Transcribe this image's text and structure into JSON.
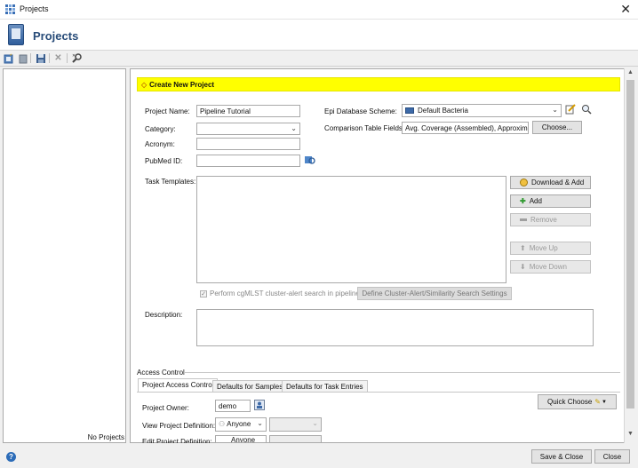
{
  "window": {
    "title": "Projects",
    "close_glyph": "✕"
  },
  "header": {
    "title": "Projects",
    "icon": "project-book-icon"
  },
  "toolbar": {
    "icons": [
      "new-project-icon",
      "delete-icon",
      "save-icon",
      "cancel-icon",
      "settings-icon"
    ]
  },
  "left_panel": {
    "footer_text": "No Projects"
  },
  "form": {
    "banner": "Create New Project",
    "project_name_label": "Project Name:",
    "project_name_value": "Pipeline Tutorial",
    "category_label": "Category:",
    "category_value": "",
    "acronym_label": "Acronym:",
    "acronym_value": "",
    "pubmed_label": "PubMed ID:",
    "pubmed_value": "",
    "epi_scheme_label": "Epi Database Scheme:",
    "epi_scheme_value": "Default Bacteria",
    "comparison_fields_label": "Comparison Table Fields:",
    "comparison_fields_value": "Avg. Coverage (Assembled), Approximat",
    "choose_button": "Choose...",
    "task_templates_label": "Task Templates:",
    "download_add_button": "Download & Add",
    "add_button": "Add",
    "remove_button": "Remove",
    "move_up_button": "Move Up",
    "move_down_button": "Move Down",
    "cgmlst_checkbox_label": "Perform cgMLST cluster-alert search in pipelines",
    "cgmlst_checked": true,
    "define_settings_button": "Define Cluster-Alert/Similarity Search Settings",
    "description_label": "Description:",
    "description_value": ""
  },
  "access": {
    "section_title": "Access Control",
    "tabs": [
      "Project Access Control",
      "Defaults for Samples",
      "Defaults for Task Entries"
    ],
    "active_tab": "Project Access Control",
    "owner_label": "Project Owner:",
    "owner_value": "demo",
    "view_def_label": "View Project Definition:",
    "view_def_value": "Anyone",
    "edit_def_label": "Edit Project Definition:",
    "edit_def_value": "Anyone",
    "quick_choose_button": "Quick Choose"
  },
  "footer": {
    "save_close_button": "Save & Close",
    "close_button": "Close",
    "help_glyph": "?"
  },
  "colors": {
    "banner": "#ffff00",
    "header_title": "#274b78",
    "accent": "#2c6cb8"
  }
}
